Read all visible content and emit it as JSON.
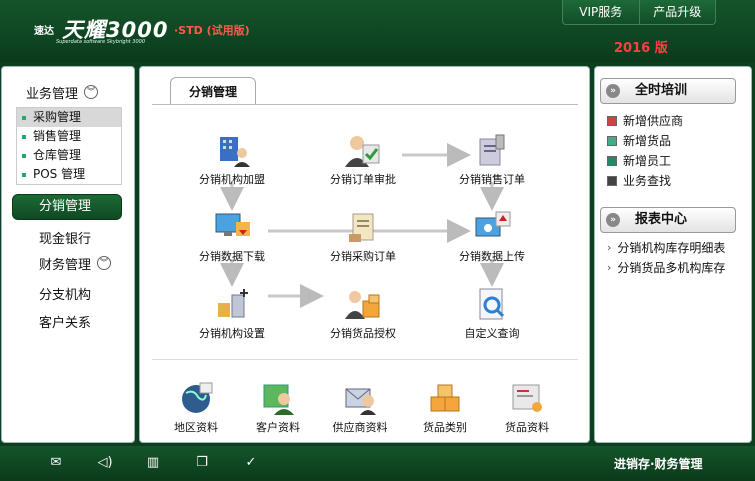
{
  "header": {
    "brand_small": "速达",
    "brand_big": "天耀3000",
    "edition": "·STD (试用版)",
    "brand_sub": "Superdata software Skybright 3000",
    "vip_button": "VIP服务",
    "upgrade_button": "产品升级",
    "version": "2016 版"
  },
  "sidebar": {
    "group_business": "业务管理",
    "sub_items": [
      "采购管理",
      "销售管理",
      "仓库管理",
      "POS 管理"
    ],
    "active_item": "分销管理",
    "item_cash": "现金银行",
    "group_finance": "财务管理",
    "item_branch": "分支机构",
    "item_customer": "客户关系"
  },
  "main": {
    "tab_label": "分销管理",
    "functions": {
      "join": "分销机构加盟",
      "order_review": "分销订单审批",
      "sales_order": "分销销售订单",
      "download": "分销数据下载",
      "purchase_order": "分销采购订单",
      "upload": "分销数据上传",
      "org_settings": "分销机构设置",
      "goods_auth": "分销货品授权",
      "custom_query": "自定义查询"
    },
    "resources": {
      "region": "地区资料",
      "customer": "客户资料",
      "supplier": "供应商资料",
      "category": "货品类别",
      "goods": "货品资料"
    }
  },
  "right": {
    "training_title": "全时培训",
    "training_links": [
      "新增供应商",
      "新增货品",
      "新增员工",
      "业务查找"
    ],
    "report_title": "报表中心",
    "report_links": [
      "分销机构库存明细表",
      "分销货品多机构库存"
    ]
  },
  "footer": {
    "title": "进销存·财务管理"
  },
  "colors": {
    "brand_green": "#0f4522",
    "accent_red": "#ff4040"
  }
}
